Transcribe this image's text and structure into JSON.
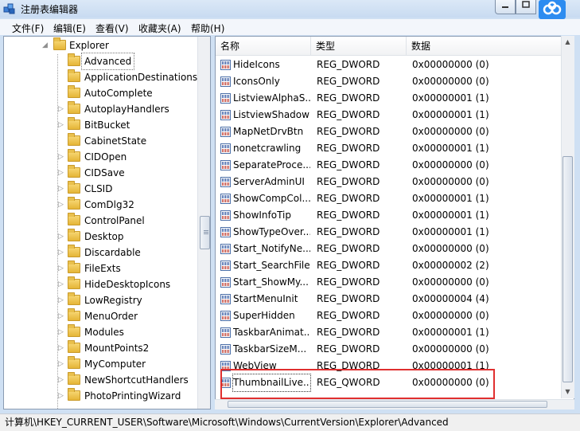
{
  "window": {
    "title": "注册表编辑器"
  },
  "menu": [
    {
      "label": "文件(F)"
    },
    {
      "label": "编辑(E)"
    },
    {
      "label": "查看(V)"
    },
    {
      "label": "收藏夹(A)"
    },
    {
      "label": "帮助(H)"
    }
  ],
  "tree": {
    "parent": "Explorer",
    "selected": "Advanced",
    "children": [
      "ApplicationDestinations",
      "AutoComplete",
      "AutoplayHandlers",
      "BitBucket",
      "CabinetState",
      "CIDOpen",
      "CIDSave",
      "CLSID",
      "ComDlg32",
      "ControlPanel",
      "Desktop",
      "Discardable",
      "FileExts",
      "HideDesktopIcons",
      "LowRegistry",
      "MenuOrder",
      "Modules",
      "MountPoints2",
      "MyComputer",
      "NewShortcutHandlers",
      "PhotoPrintingWizard"
    ]
  },
  "list": {
    "headers": {
      "name": "名称",
      "type": "类型",
      "data": "数据"
    },
    "rows": [
      {
        "name": "HideIcons",
        "type": "REG_DWORD",
        "data": "0x00000000 (0)"
      },
      {
        "name": "IconsOnly",
        "type": "REG_DWORD",
        "data": "0x00000000 (0)"
      },
      {
        "name": "ListviewAlphaS...",
        "type": "REG_DWORD",
        "data": "0x00000001 (1)"
      },
      {
        "name": "ListviewShadow",
        "type": "REG_DWORD",
        "data": "0x00000001 (1)"
      },
      {
        "name": "MapNetDrvBtn",
        "type": "REG_DWORD",
        "data": "0x00000000 (0)"
      },
      {
        "name": "nonetcrawling",
        "type": "REG_DWORD",
        "data": "0x00000001 (1)"
      },
      {
        "name": "SeparateProce...",
        "type": "REG_DWORD",
        "data": "0x00000000 (0)"
      },
      {
        "name": "ServerAdminUI",
        "type": "REG_DWORD",
        "data": "0x00000000 (0)"
      },
      {
        "name": "ShowCompCol...",
        "type": "REG_DWORD",
        "data": "0x00000001 (1)"
      },
      {
        "name": "ShowInfoTip",
        "type": "REG_DWORD",
        "data": "0x00000001 (1)"
      },
      {
        "name": "ShowTypeOver...",
        "type": "REG_DWORD",
        "data": "0x00000001 (1)"
      },
      {
        "name": "Start_NotifyNe...",
        "type": "REG_DWORD",
        "data": "0x00000000 (0)"
      },
      {
        "name": "Start_SearchFiles",
        "type": "REG_DWORD",
        "data": "0x00000002 (2)"
      },
      {
        "name": "Start_ShowMy...",
        "type": "REG_DWORD",
        "data": "0x00000000 (0)"
      },
      {
        "name": "StartMenuInit",
        "type": "REG_DWORD",
        "data": "0x00000004 (4)"
      },
      {
        "name": "SuperHidden",
        "type": "REG_DWORD",
        "data": "0x00000000 (0)"
      },
      {
        "name": "TaskbarAnimat...",
        "type": "REG_DWORD",
        "data": "0x00000001 (1)"
      },
      {
        "name": "TaskbarSizeM...",
        "type": "REG_DWORD",
        "data": "0x00000000 (0)"
      },
      {
        "name": "WebView",
        "type": "REG_DWORD",
        "data": "0x00000001 (1)"
      },
      {
        "name": "ThumbnailLive...",
        "type": "REG_QWORD",
        "data": "0x00000000 (0)"
      }
    ]
  },
  "status": {
    "path": "计算机\\HKEY_CURRENT_USER\\Software\\Microsoft\\Windows\\CurrentVersion\\Explorer\\Advanced"
  },
  "colors": {
    "highlight_box": "#e02f2f",
    "accent": "#2e55a0"
  }
}
